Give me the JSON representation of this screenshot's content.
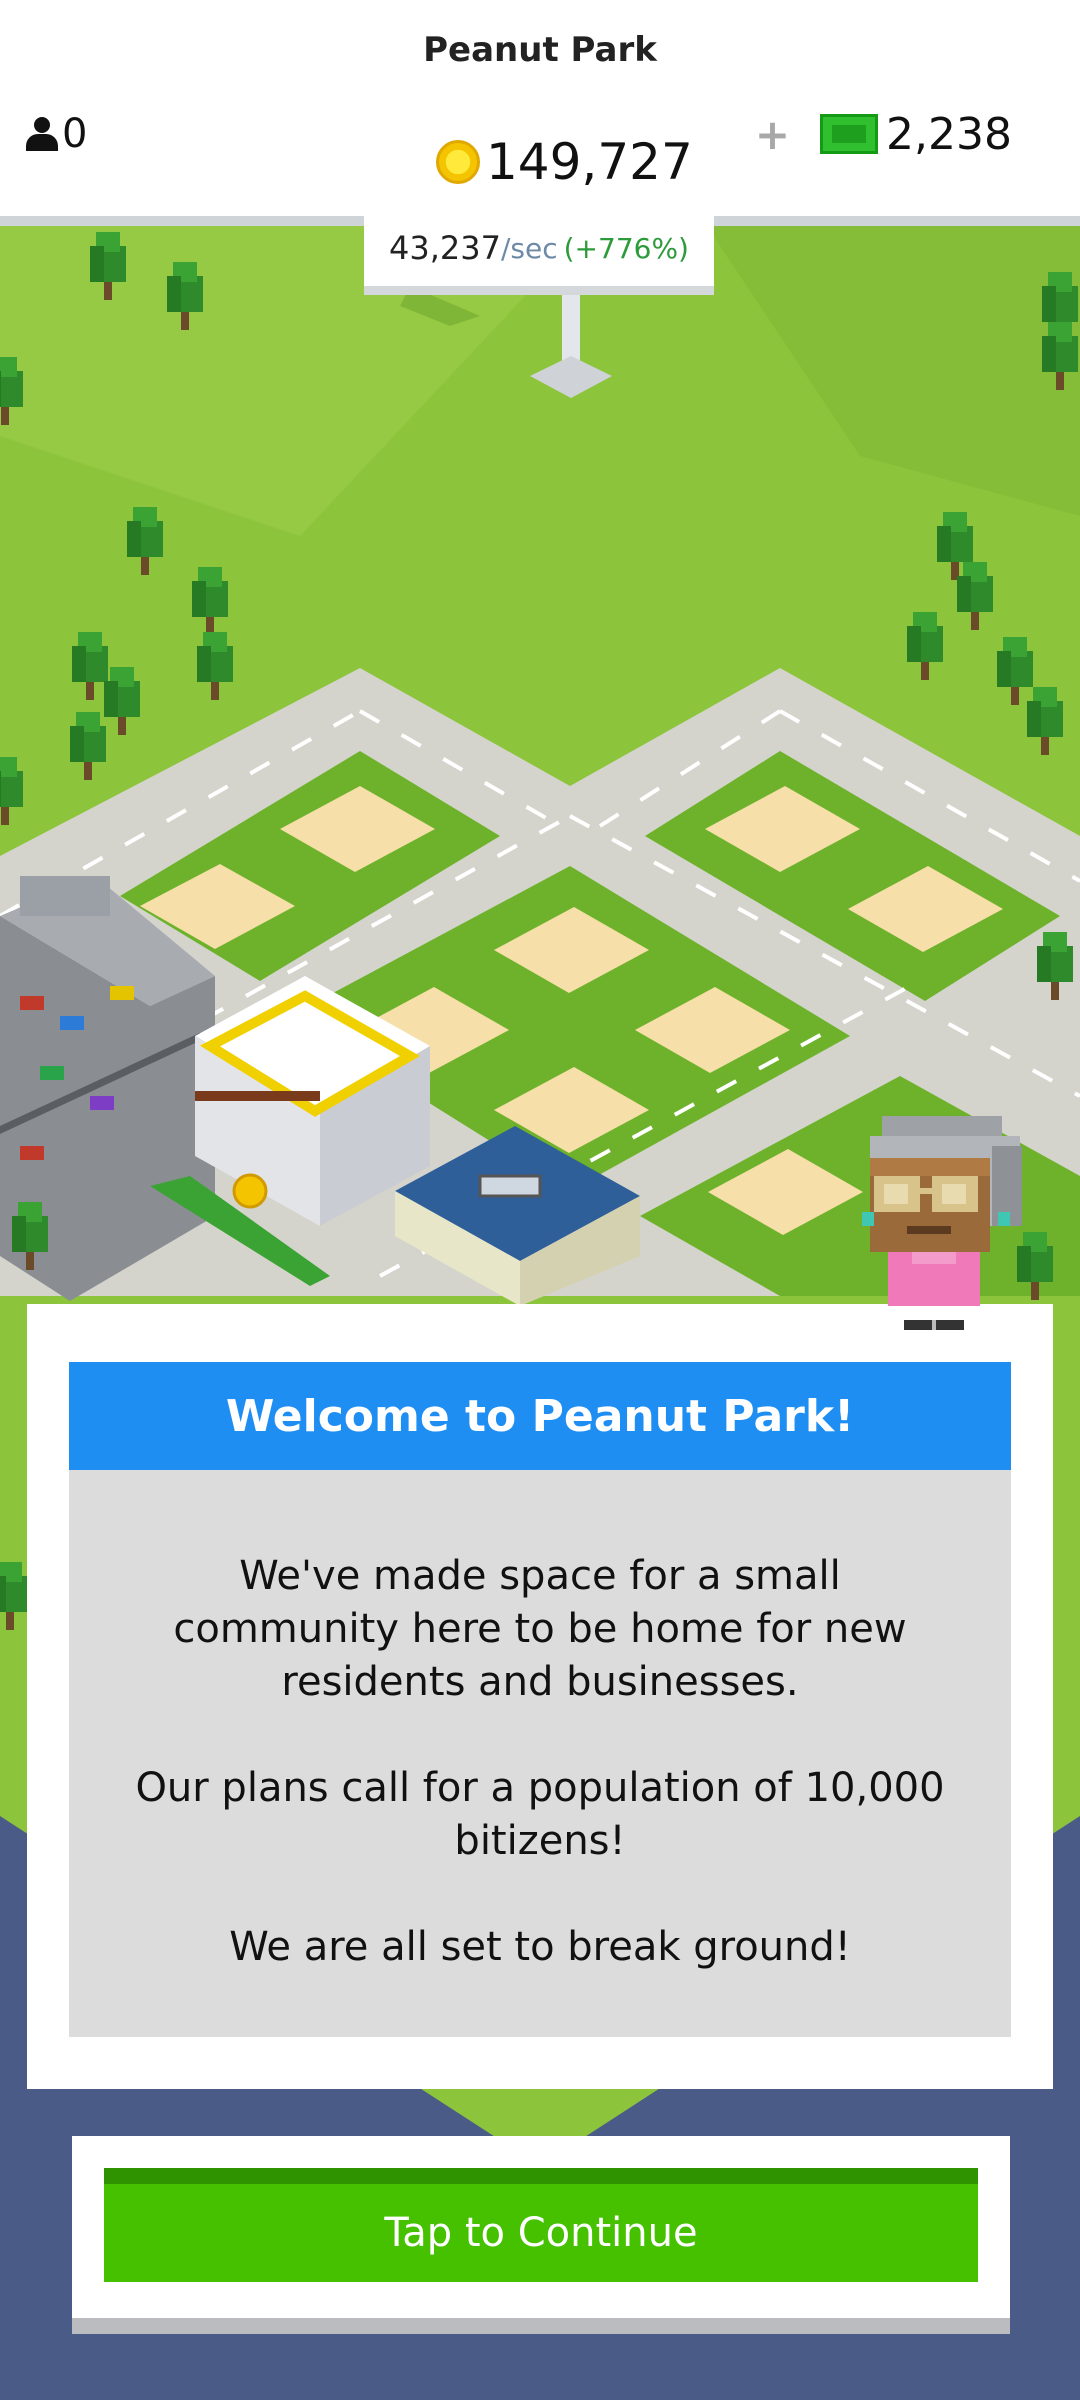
{
  "header": {
    "city_name": "Peanut Park",
    "population": "0",
    "coins": "149,727",
    "income_value": "43,237",
    "income_unit": "/sec",
    "income_bonus": "(+776%)",
    "add_bux_label": "+",
    "bux": "2,238"
  },
  "dialog": {
    "title": "Welcome to Peanut Park!",
    "paragraphs": [
      "We've made space for a small community here to be home for new residents and businesses.",
      "Our plans call for a population of 10,000 bitizens!",
      "We are all set to break ground!"
    ]
  },
  "continue_button": {
    "label": "Tap to Continue"
  },
  "icons": {
    "population": "person-icon",
    "coins": "coin-icon",
    "bux": "bux-icon"
  },
  "colors": {
    "header_blue": "#1f8ef3",
    "continue_green": "#45c100",
    "background_navy": "#4a5b87",
    "grass": "#8cc43c"
  }
}
